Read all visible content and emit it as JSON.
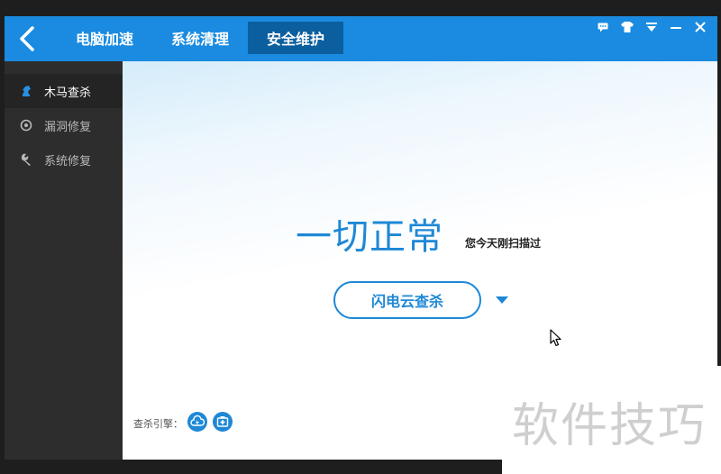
{
  "header": {
    "tabs": [
      {
        "label": "电脑加速",
        "active": false
      },
      {
        "label": "系统清理",
        "active": false
      },
      {
        "label": "安全维护",
        "active": true
      }
    ]
  },
  "window_controls": [
    "feedback-icon",
    "skin-icon",
    "menu-icon",
    "minimize-icon",
    "close-icon"
  ],
  "sidebar": {
    "items": [
      {
        "label": "木马查杀",
        "icon": "horse-icon",
        "active": true
      },
      {
        "label": "漏洞修复",
        "icon": "patch-icon",
        "active": false
      },
      {
        "label": "系统修复",
        "icon": "wrench-icon",
        "active": false
      }
    ]
  },
  "main": {
    "status_title": "一切正常",
    "status_subtitle": "您今天刚扫描过",
    "scan_button": "闪电云查杀",
    "engine_label": "查杀引擎："
  },
  "watermark": "软件技巧",
  "colors": {
    "accent": "#1a8be0",
    "active_tab": "#0c5f9e",
    "sidebar": "#2d2d2d",
    "text_blue": "#1e88d6"
  }
}
